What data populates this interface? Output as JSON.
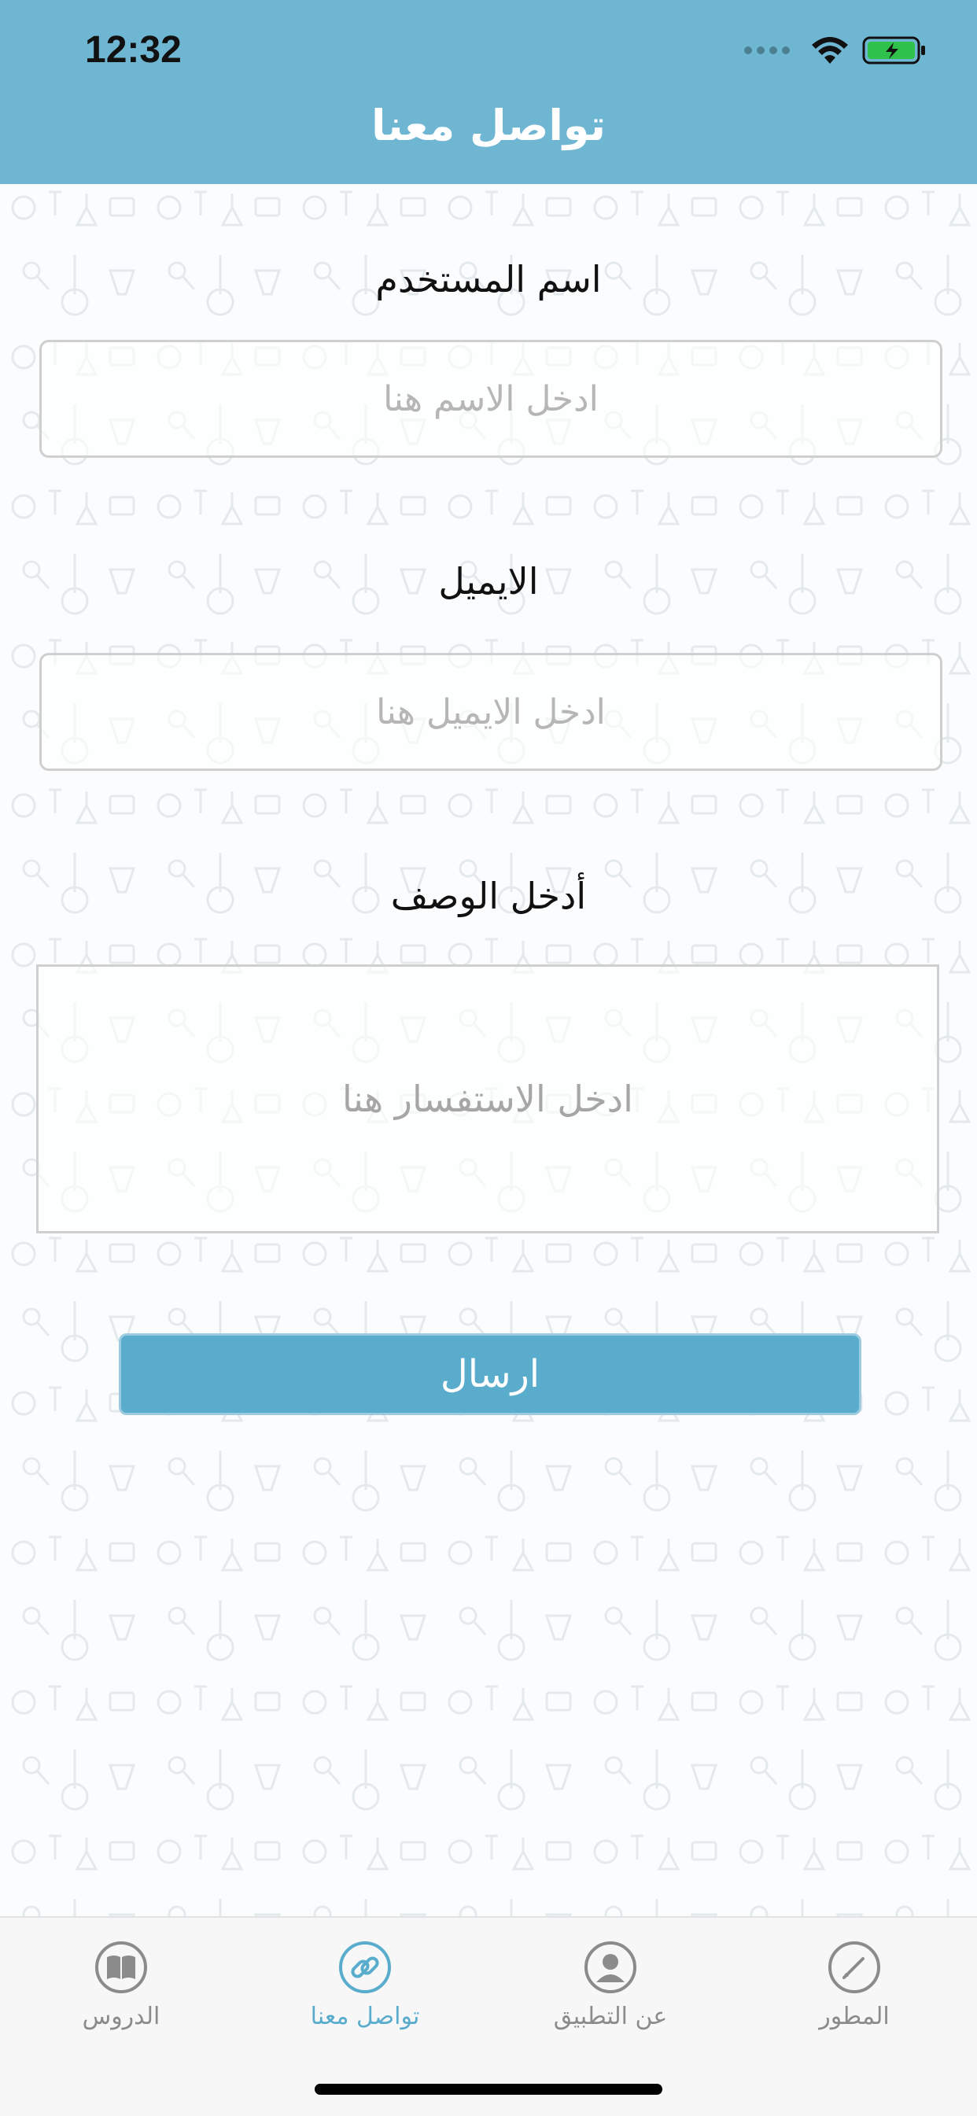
{
  "status_bar": {
    "time": "12:32"
  },
  "header": {
    "title": "تواصل معنا"
  },
  "form": {
    "username_label": "اسم المستخدم",
    "username_placeholder": "ادخل الاسم هنا",
    "email_label": "الايميل",
    "email_placeholder": "ادخل الايميل هنا",
    "description_label": "أدخل الوصف",
    "description_placeholder": "ادخل الاستفسار هنا",
    "send_label": "ارسال"
  },
  "tabbar": {
    "items": [
      {
        "label": "الدروس",
        "icon": "book-icon"
      },
      {
        "label": "تواصل معنا",
        "icon": "link-icon"
      },
      {
        "label": "عن التطبيق",
        "icon": "person-icon"
      },
      {
        "label": "المطور",
        "icon": "pencil-icon"
      }
    ],
    "active_index": 1
  },
  "colors": {
    "header": "#6fb6d3",
    "accent": "#5aaccd",
    "tab_inactive": "#8b8b8b"
  }
}
